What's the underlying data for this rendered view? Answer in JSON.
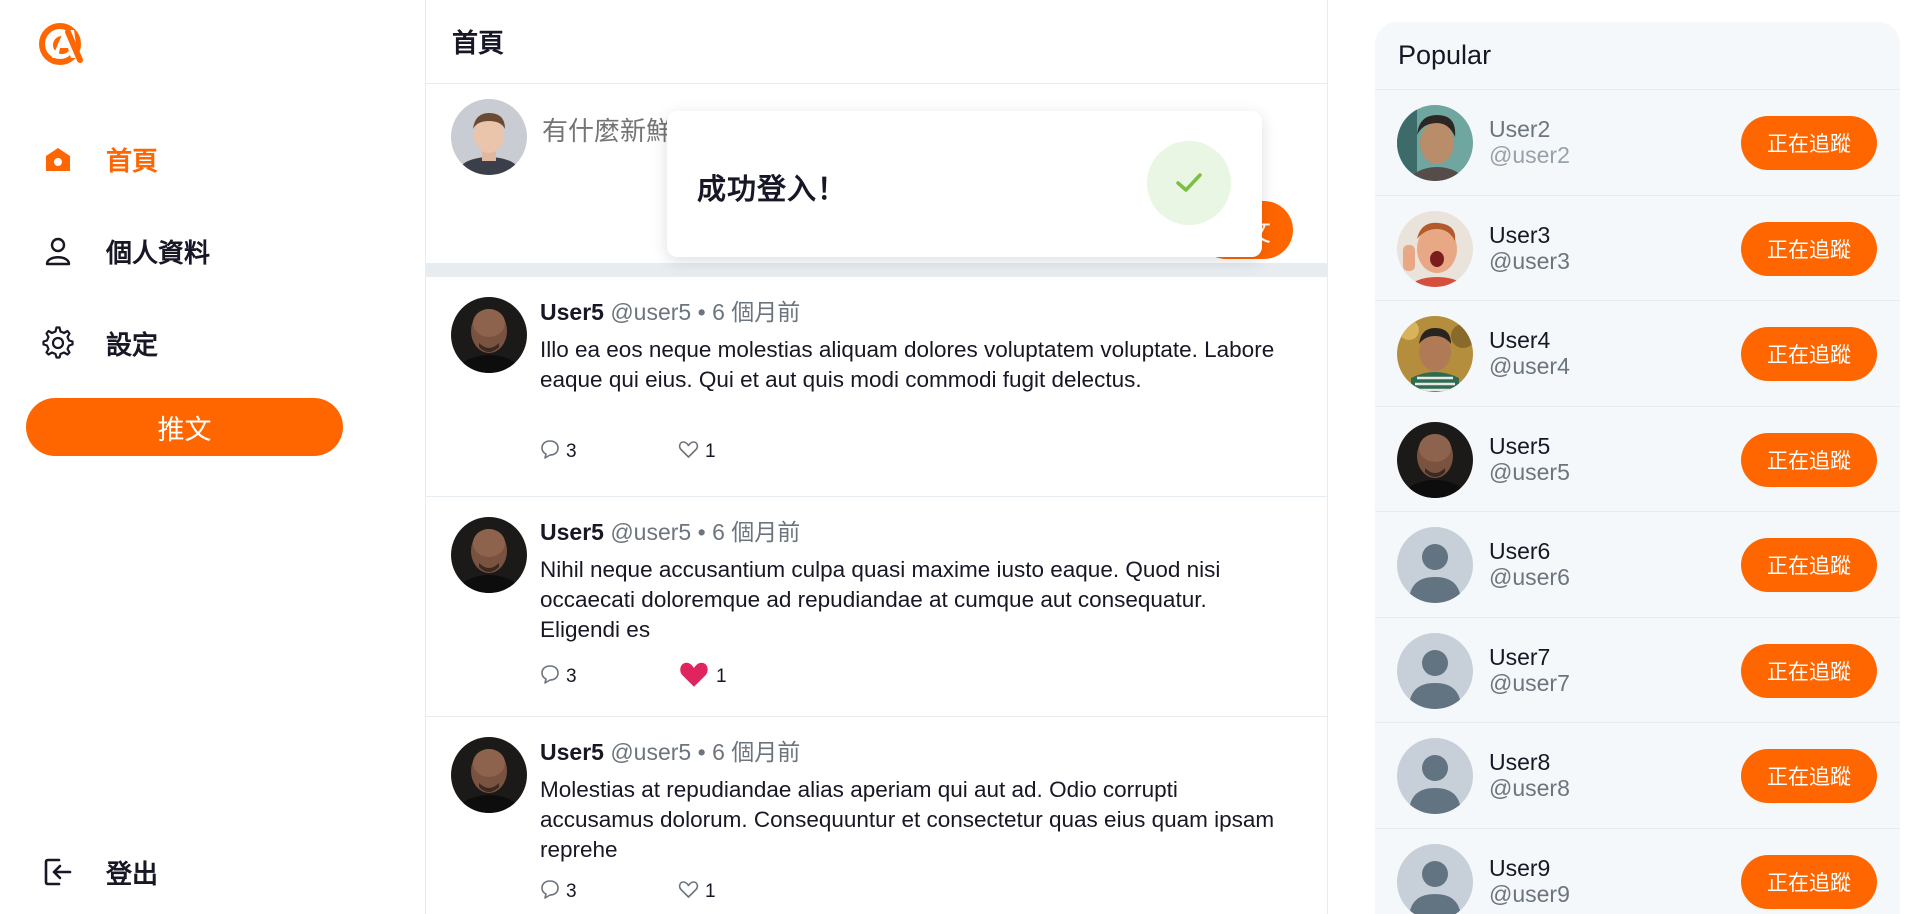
{
  "brand": {
    "accent": "#ff6600",
    "logo": "alphacamp-logo"
  },
  "sidebar": {
    "items": [
      {
        "label": "首頁",
        "icon": "home-icon",
        "active": true
      },
      {
        "label": "個人資料",
        "icon": "user-icon",
        "active": false
      },
      {
        "label": "設定",
        "icon": "gear-icon",
        "active": false
      }
    ],
    "tweet_button": "推文",
    "logout": {
      "label": "登出",
      "icon": "logout-icon"
    }
  },
  "main": {
    "title": "首頁",
    "composer": {
      "placeholder": "有什麼新鮮事？",
      "post_label": "推文"
    },
    "tweets": [
      {
        "name": "User5",
        "handle": "@user5",
        "dot": "•",
        "time": "6 個月前",
        "text": "Illo ea eos neque molestias aliquam dolores voluptatem voluptate. Labore eaque qui eius. Qui et aut quis modi commodi fugit delectus.",
        "replies": "3",
        "likes": "1",
        "liked": false
      },
      {
        "name": "User5",
        "handle": "@user5",
        "dot": "•",
        "time": "6 個月前",
        "text": "Nihil neque accusantium culpa quasi maxime iusto eaque. Quod nisi occaecati doloremque ad repudiandae at cumque aut consequatur. Eligendi es",
        "replies": "3",
        "likes": "1",
        "liked": true
      },
      {
        "name": "User5",
        "handle": "@user5",
        "dot": "•",
        "time": "6 個月前",
        "text": "Molestias at repudiandae alias aperiam qui aut ad. Odio corrupti accusamus dolorum. Consequuntur et consectetur quas eius quam ipsam reprehe",
        "replies": "3",
        "likes": "1",
        "liked": false
      }
    ]
  },
  "toast": {
    "message": "成功登入！",
    "icon": "check-icon",
    "color": "#7ac142"
  },
  "popular": {
    "title": "Popular",
    "users": [
      {
        "name": "User2",
        "handle": "@user2",
        "follow_label": "正在追蹤",
        "avatar": "photo"
      },
      {
        "name": "User3",
        "handle": "@user3",
        "follow_label": "正在追蹤",
        "avatar": "photo"
      },
      {
        "name": "User4",
        "handle": "@user4",
        "follow_label": "正在追蹤",
        "avatar": "photo"
      },
      {
        "name": "User5",
        "handle": "@user5",
        "follow_label": "正在追蹤",
        "avatar": "photo"
      },
      {
        "name": "User6",
        "handle": "@user6",
        "follow_label": "正在追蹤",
        "avatar": "default"
      },
      {
        "name": "User7",
        "handle": "@user7",
        "follow_label": "正在追蹤",
        "avatar": "default"
      },
      {
        "name": "User8",
        "handle": "@user8",
        "follow_label": "正在追蹤",
        "avatar": "default"
      },
      {
        "name": "User9",
        "handle": "@user9",
        "follow_label": "正在追蹤",
        "avatar": "default"
      }
    ]
  }
}
